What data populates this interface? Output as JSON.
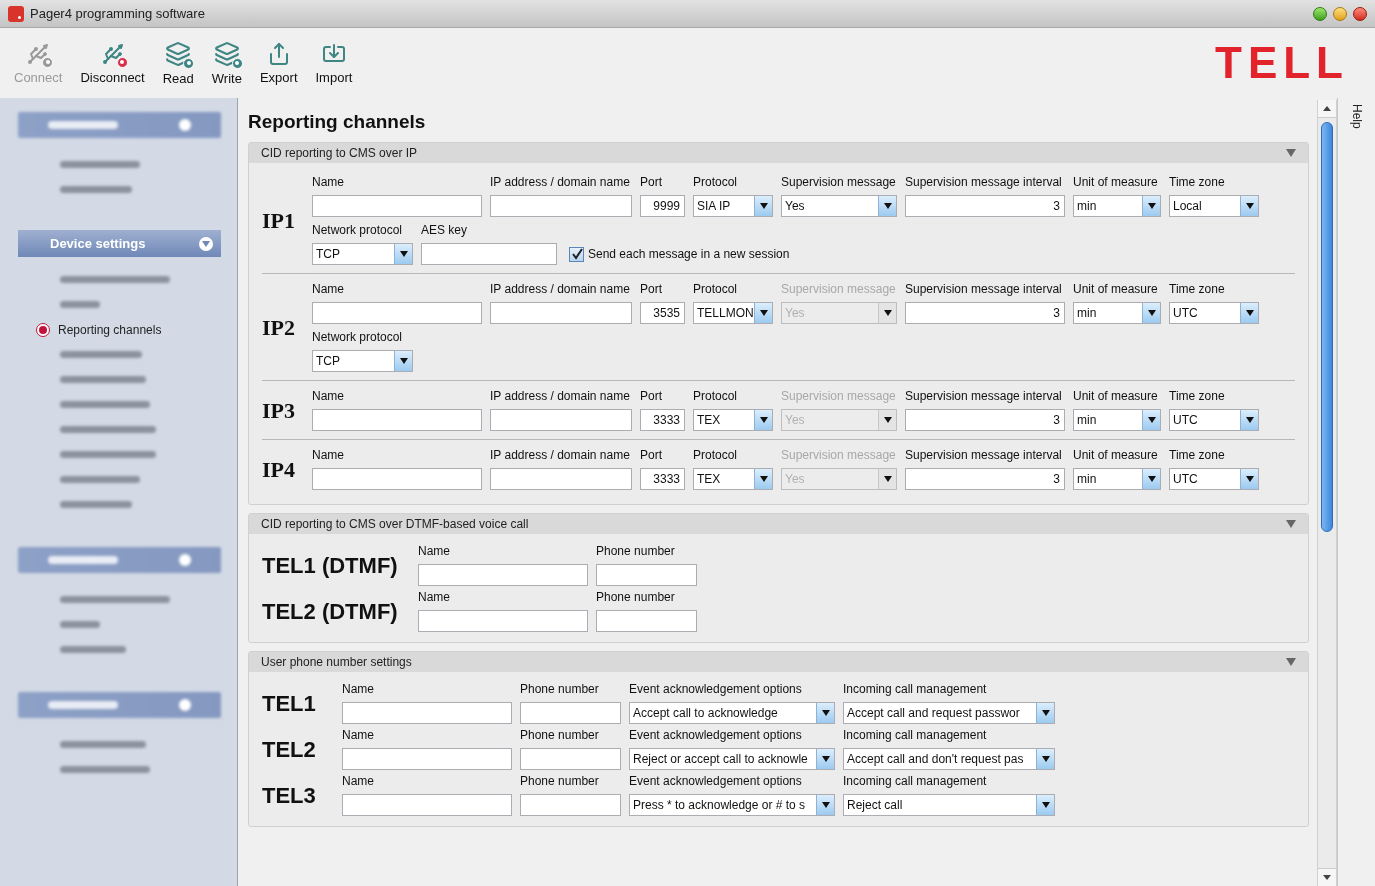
{
  "window": {
    "title": "Pager4 programming software"
  },
  "toolbar": [
    {
      "label": "Connect",
      "kind": "connect",
      "disabled": true
    },
    {
      "label": "Disconnect",
      "kind": "disconnect",
      "disabled": false
    },
    {
      "label": "Read",
      "kind": "read",
      "disabled": false
    },
    {
      "label": "Write",
      "kind": "write",
      "disabled": false
    },
    {
      "label": "Export",
      "kind": "export",
      "disabled": false
    },
    {
      "label": "Import",
      "kind": "import",
      "disabled": false
    }
  ],
  "logo": "TELL",
  "help_tab": "Help",
  "sidebar": [
    {
      "kind": "blurred_header",
      "selected": false
    },
    {
      "kind": "blurred_item",
      "selected": false
    },
    {
      "kind": "blurred_item",
      "selected": false
    },
    {
      "kind": "header",
      "label": "Device settings",
      "selected": false
    },
    {
      "kind": "blurred_item",
      "selected": false
    },
    {
      "kind": "blurred_item",
      "selected": false
    },
    {
      "kind": "item",
      "label": "Reporting channels",
      "selected": true
    },
    {
      "kind": "blurred_item",
      "selected": false
    },
    {
      "kind": "blurred_item",
      "selected": false
    },
    {
      "kind": "blurred_item",
      "selected": false
    },
    {
      "kind": "blurred_item",
      "selected": false
    },
    {
      "kind": "blurred_item",
      "selected": false
    },
    {
      "kind": "blurred_item",
      "selected": false
    },
    {
      "kind": "blurred_item",
      "selected": false
    },
    {
      "kind": "blurred_header",
      "selected": false
    },
    {
      "kind": "blurred_item",
      "selected": false
    },
    {
      "kind": "blurred_item",
      "selected": false
    },
    {
      "kind": "blurred_item",
      "selected": false
    },
    {
      "kind": "blurred_header",
      "selected": false
    },
    {
      "kind": "blurred_item",
      "selected": false
    },
    {
      "kind": "blurred_item",
      "selected": false
    }
  ],
  "page_title": "Reporting channels",
  "sections": [
    {
      "kind": "ip",
      "title": "CID reporting to CMS over IP",
      "rows": [
        {
          "label": "IP1",
          "fields": [
            {
              "kind": "text",
              "label": "Name",
              "disabled": false
            },
            {
              "kind": "text",
              "label": "IP address / domain name",
              "disabled": false
            },
            {
              "kind": "number",
              "label": "Port",
              "value": "9999",
              "disabled": false
            },
            {
              "kind": "select",
              "label": "Protocol",
              "value": "SIA IP",
              "disabled": false
            },
            {
              "kind": "select",
              "label": "Supervision message",
              "value": "Yes",
              "disabled": false
            },
            {
              "kind": "number",
              "label": "Supervision message interval",
              "value": "3",
              "disabled": false
            },
            {
              "kind": "select",
              "label": "Unit of measure",
              "value": "min",
              "disabled": false
            },
            {
              "kind": "select",
              "label": "Time zone",
              "value": "Local",
              "disabled": false
            }
          ],
          "extra": [
            {
              "kind": "select",
              "label": "Network protocol",
              "value": "TCP",
              "disabled": false
            },
            {
              "kind": "text",
              "label": "AES key",
              "disabled": false
            },
            {
              "kind": "checkbox",
              "label": "Send each message in a new session",
              "checked": true,
              "disabled": false
            }
          ]
        },
        {
          "label": "IP2",
          "fields": [
            {
              "kind": "text",
              "label": "Name",
              "disabled": false
            },
            {
              "kind": "text",
              "label": "IP address / domain name",
              "disabled": false
            },
            {
              "kind": "number",
              "label": "Port",
              "value": "3535",
              "disabled": false
            },
            {
              "kind": "select",
              "label": "Protocol",
              "value": "TELLMON",
              "disabled": false
            },
            {
              "kind": "select",
              "label": "Supervision message",
              "value": "Yes",
              "disabled": true
            },
            {
              "kind": "number",
              "label": "Supervision message interval",
              "value": "3",
              "disabled": false
            },
            {
              "kind": "select",
              "label": "Unit of measure",
              "value": "min",
              "disabled": false
            },
            {
              "kind": "select",
              "label": "Time zone",
              "value": "UTC",
              "disabled": false
            }
          ],
          "extra": [
            {
              "kind": "select",
              "label": "Network protocol",
              "value": "TCP",
              "disabled": false
            }
          ]
        },
        {
          "label": "IP3",
          "fields": [
            {
              "kind": "text",
              "label": "Name",
              "disabled": false
            },
            {
              "kind": "text",
              "label": "IP address / domain name",
              "disabled": false
            },
            {
              "kind": "number",
              "label": "Port",
              "value": "3333",
              "disabled": false
            },
            {
              "kind": "select",
              "label": "Protocol",
              "value": "TEX",
              "disabled": false
            },
            {
              "kind": "select",
              "label": "Supervision message",
              "value": "Yes",
              "disabled": true
            },
            {
              "kind": "number",
              "label": "Supervision message interval",
              "value": "3",
              "disabled": false
            },
            {
              "kind": "select",
              "label": "Unit of measure",
              "value": "min",
              "disabled": false
            },
            {
              "kind": "select",
              "label": "Time zone",
              "value": "UTC",
              "disabled": false
            }
          ]
        },
        {
          "label": "IP4",
          "fields": [
            {
              "kind": "text",
              "label": "Name",
              "disabled": false
            },
            {
              "kind": "text",
              "label": "IP address / domain name",
              "disabled": false
            },
            {
              "kind": "number",
              "label": "Port",
              "value": "3333",
              "disabled": false
            },
            {
              "kind": "select",
              "label": "Protocol",
              "value": "TEX",
              "disabled": false
            },
            {
              "kind": "select",
              "label": "Supervision message",
              "value": "Yes",
              "disabled": true
            },
            {
              "kind": "number",
              "label": "Supervision message interval",
              "value": "3",
              "disabled": false
            },
            {
              "kind": "select",
              "label": "Unit of measure",
              "value": "min",
              "disabled": false
            },
            {
              "kind": "select",
              "label": "Time zone",
              "value": "UTC",
              "disabled": false
            }
          ]
        }
      ]
    },
    {
      "kind": "dtmf",
      "title": "CID reporting to CMS over DTMF-based voice call",
      "rows": [
        {
          "label": "TEL1 (DTMF)",
          "fields": [
            {
              "kind": "text",
              "label": "Name",
              "disabled": false
            },
            {
              "kind": "text",
              "label": "Phone number",
              "disabled": false
            }
          ]
        },
        {
          "label": "TEL2 (DTMF)",
          "fields": [
            {
              "kind": "text",
              "label": "Name",
              "disabled": false
            },
            {
              "kind": "text",
              "label": "Phone number",
              "disabled": false
            }
          ]
        }
      ]
    },
    {
      "kind": "user",
      "title": "User phone number settings",
      "rows": [
        {
          "label": "TEL1",
          "fields": [
            {
              "kind": "text",
              "label": "Name",
              "disabled": false
            },
            {
              "kind": "text",
              "label": "Phone number",
              "disabled": false
            },
            {
              "kind": "select",
              "label": "Event acknowledgement options",
              "value": "Accept call to acknowledge",
              "disabled": false
            },
            {
              "kind": "select",
              "label": "Incoming call management",
              "value": "Accept call and request passwor",
              "disabled": false
            }
          ]
        },
        {
          "label": "TEL2",
          "fields": [
            {
              "kind": "text",
              "label": "Name",
              "disabled": false
            },
            {
              "kind": "text",
              "label": "Phone number",
              "disabled": false
            },
            {
              "kind": "select",
              "label": "Event acknowledgement options",
              "value": "Reject or accept call to acknowle",
              "disabled": false
            },
            {
              "kind": "select",
              "label": "Incoming call management",
              "value": "Accept call and don't request pas",
              "disabled": false
            }
          ]
        },
        {
          "label": "TEL3",
          "fields": [
            {
              "kind": "text",
              "label": "Name",
              "disabled": false
            },
            {
              "kind": "text",
              "label": "Phone number",
              "disabled": false
            },
            {
              "kind": "select",
              "label": "Event acknowledgement options",
              "value": "Press * to acknowledge or # to s",
              "disabled": false
            },
            {
              "kind": "select",
              "label": "Incoming call management",
              "value": "Reject call",
              "disabled": false
            }
          ]
        }
      ]
    }
  ]
}
